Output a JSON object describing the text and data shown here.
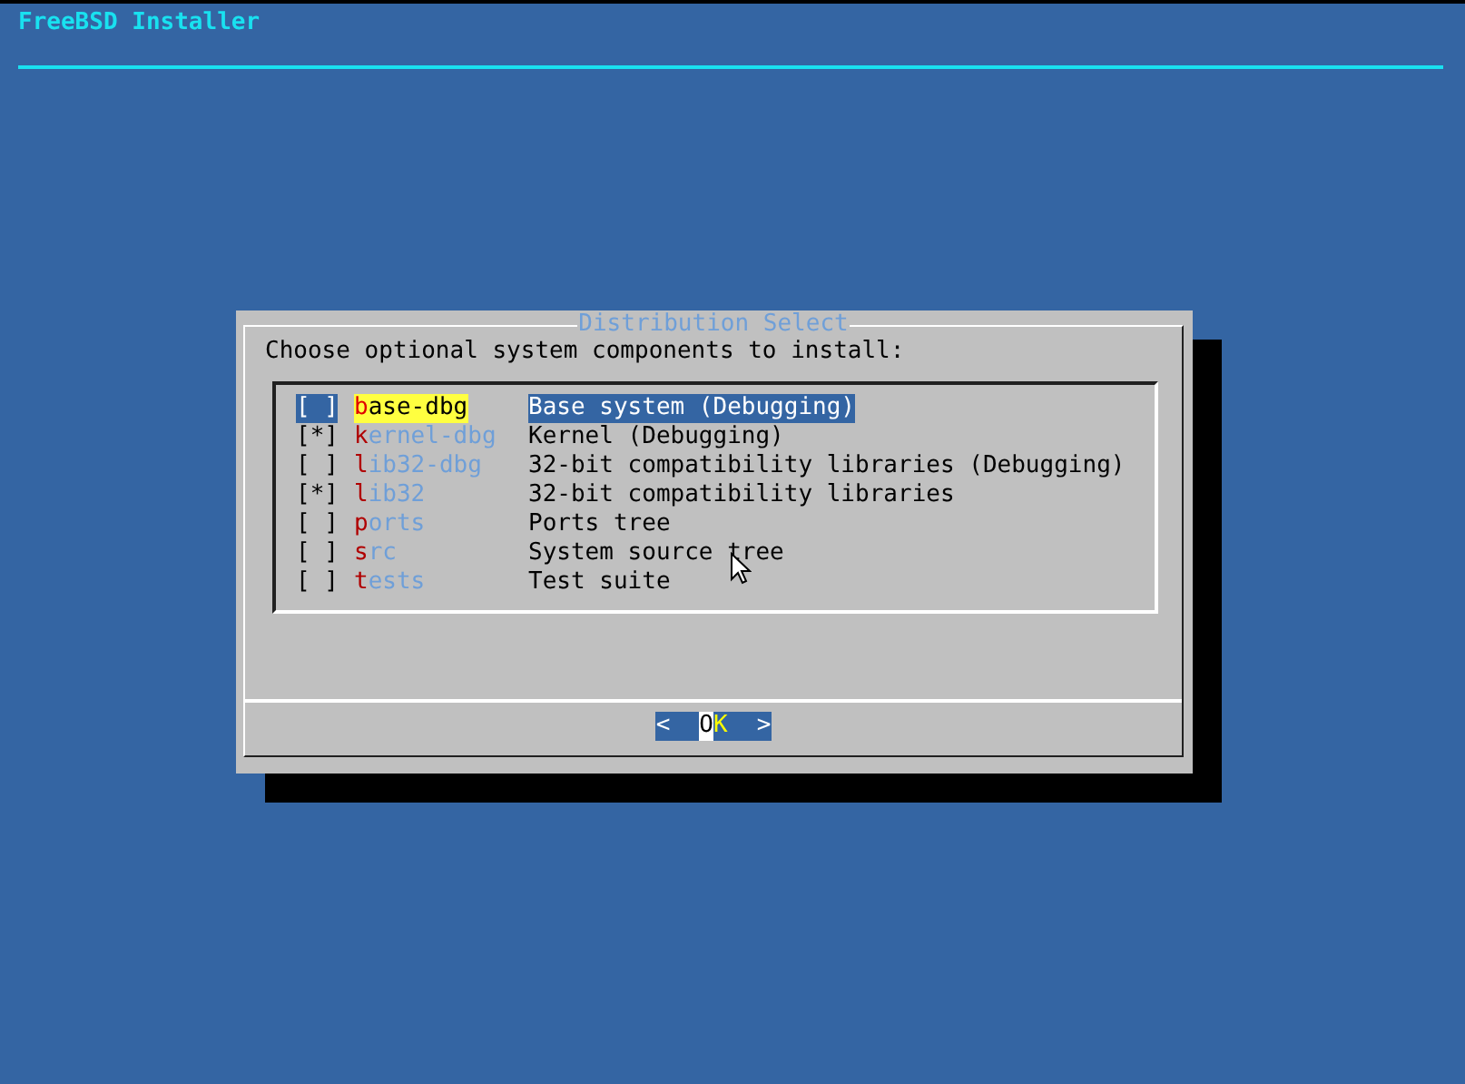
{
  "screen": {
    "title": "FreeBSD Installer"
  },
  "dialog": {
    "title": "Distribution Select",
    "prompt": "Choose optional system components to install:",
    "items": [
      {
        "box": "[ ]",
        "name": "base-dbg",
        "description": "Base system (Debugging)",
        "selected": true
      },
      {
        "box": "[*]",
        "name": "kernel-dbg",
        "description": "Kernel (Debugging)",
        "selected": false
      },
      {
        "box": "[ ]",
        "name": "lib32-dbg",
        "description": "32-bit compatibility libraries (Debugging)",
        "selected": false
      },
      {
        "box": "[*]",
        "name": "lib32",
        "description": "32-bit compatibility libraries",
        "selected": false
      },
      {
        "box": "[ ]",
        "name": "ports",
        "description": "Ports tree",
        "selected": false
      },
      {
        "box": "[ ]",
        "name": "src",
        "description": "System source tree",
        "selected": false
      },
      {
        "box": "[ ]",
        "name": "tests",
        "description": "Test suite",
        "selected": false
      }
    ],
    "buttons": [
      {
        "open": "<",
        "label": "OK",
        "close": ">",
        "selected": true
      }
    ]
  }
}
